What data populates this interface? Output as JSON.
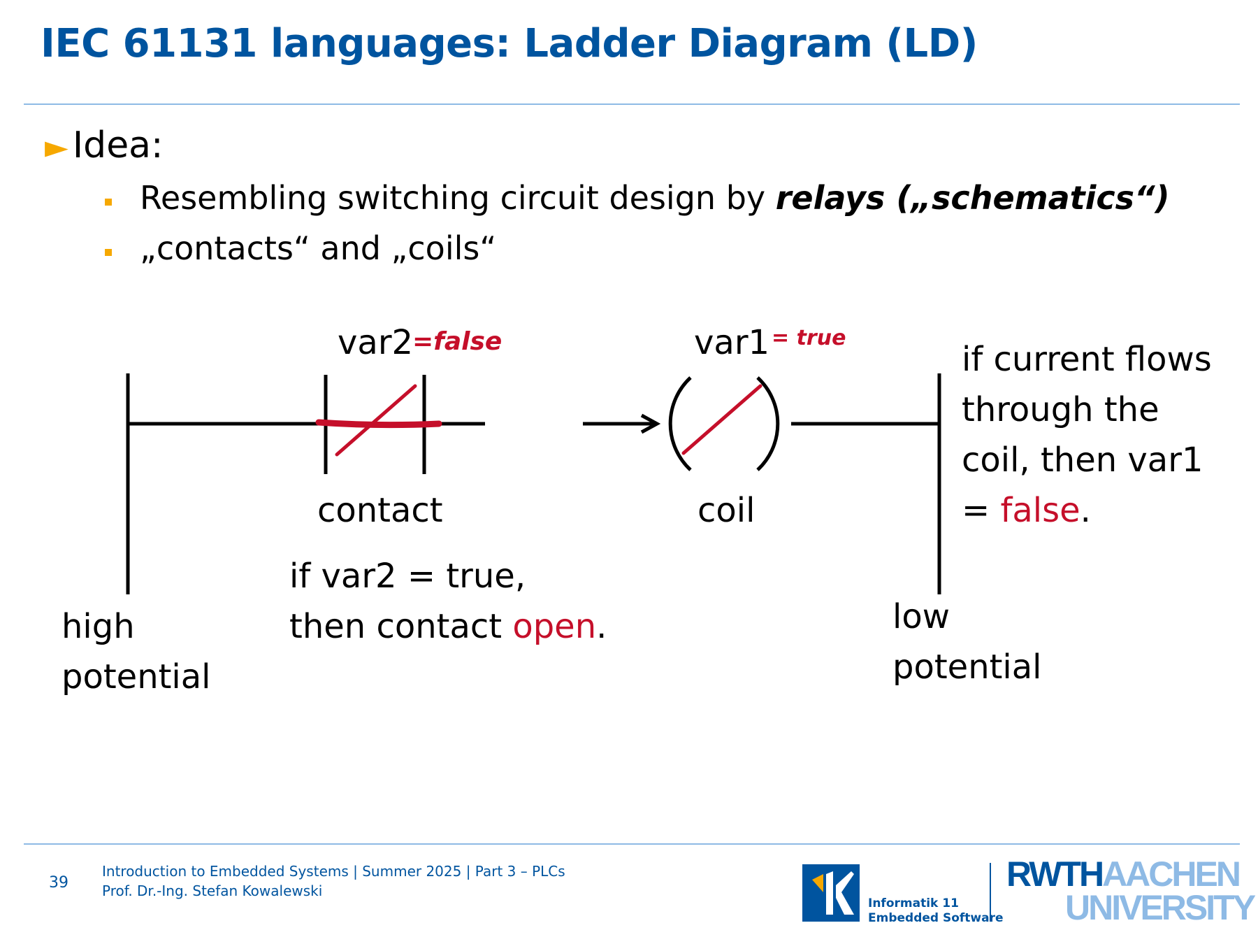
{
  "title": "IEC 61131 languages: Ladder Diagram (LD)",
  "level1": "Idea:",
  "bullets": {
    "b1_prefix": "Resembling switching circuit design by ",
    "b1_bold": "relays („schematics“)",
    "b2": "„contacts“ and „coils“"
  },
  "diagram": {
    "var2": "var2",
    "var2_note": "=false",
    "var1": "var1",
    "var1_note": "= true",
    "contact_label": "contact",
    "coil_label": "coil",
    "contact_note_l1": "if var2 = true,",
    "contact_note_l2_prefix": "then contact ",
    "contact_note_l2_red": "open",
    "contact_note_l2_suffix": ".",
    "coil_note_l1": "if current flows",
    "coil_note_l2": "through the",
    "coil_note_l3": "coil, then var1",
    "coil_note_l4_prefix": "= ",
    "coil_note_l4_red": "false",
    "coil_note_l4_suffix": ".",
    "high_l1": "high",
    "high_l2": "potential",
    "low_l1": "low",
    "low_l2": "potential"
  },
  "footer": {
    "page": "39",
    "line1": "Introduction to Embedded Systems | Summer 2025 | Part 3 – PLCs",
    "line2": "Prof. Dr.-Ing. Stefan Kowalewski",
    "i11_line1": "Informatik 11",
    "i11_line2": "Embedded Software",
    "rwth_dark": "RWTH",
    "rwth_light1": "AACHEN",
    "rwth_light2": "UNIVERSITY"
  },
  "colors": {
    "title_blue": "#00549f",
    "light_blue": "#8ebae5",
    "bullet_orange": "#f6a800",
    "annotation_red": "#c50f2a"
  }
}
